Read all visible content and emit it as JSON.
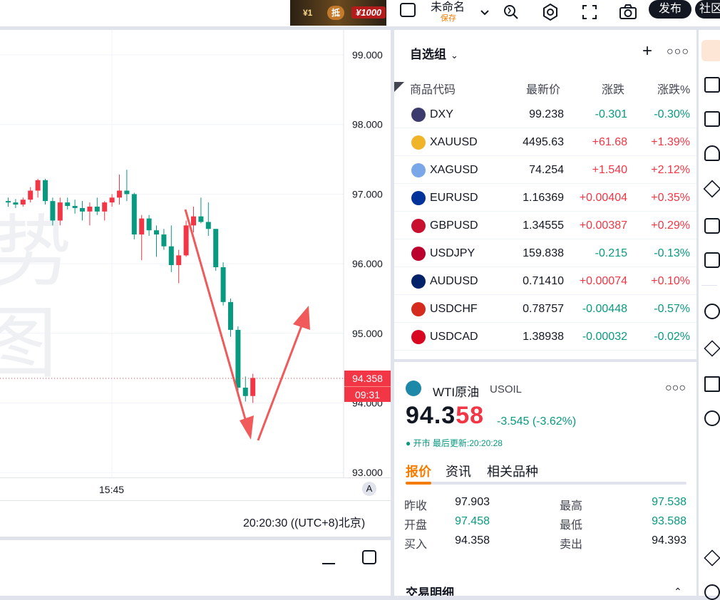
{
  "topbar": {
    "promo": {
      "a": "¥1",
      "b": "抵",
      "c": "¥1000"
    },
    "doc_name": "未命名",
    "doc_status": "保存",
    "publish_label": "发布",
    "community_label": "社区"
  },
  "chart": {
    "price_ticks": [
      "99.000",
      "98.000",
      "97.000",
      "96.000",
      "95.000",
      "94.000",
      "93.000"
    ],
    "last_price_label": "94.358",
    "countdown_label": "09:31",
    "time_tick": "15:45",
    "auto_label": "A",
    "watermark_chars": [
      "势",
      "图"
    ],
    "clock": "20:20:30 ((UTC+8)北京)",
    "up_color": "#f23645",
    "down_color": "#089981"
  },
  "bottom_panel": {
    "min_icon": "minimize-icon",
    "max_icon": "maximize-icon"
  },
  "watchlist": {
    "title": "自选组",
    "columns": {
      "symbol": "商品代码",
      "last": "最新价",
      "chg": "涨跌",
      "chg_pct": "涨跌%"
    },
    "rows": [
      {
        "sym": "DXY",
        "last": "99.238",
        "chg": "-0.301",
        "pct": "-0.30%",
        "dir": "neg",
        "flag": "#3c3b6e"
      },
      {
        "sym": "XAUUSD",
        "last": "4495.63",
        "chg": "+61.68",
        "pct": "+1.39%",
        "dir": "pos",
        "flag": "#f0b429"
      },
      {
        "sym": "XAGUSD",
        "last": "74.254",
        "chg": "+1.540",
        "pct": "+2.12%",
        "dir": "pos",
        "flag": "#7aa7e8"
      },
      {
        "sym": "EURUSD",
        "last": "1.16369",
        "chg": "+0.00404",
        "pct": "+0.35%",
        "dir": "pos",
        "flag": "#003399"
      },
      {
        "sym": "GBPUSD",
        "last": "1.34555",
        "chg": "+0.00387",
        "pct": "+0.29%",
        "dir": "pos",
        "flag": "#c8102e"
      },
      {
        "sym": "USDJPY",
        "last": "159.838",
        "chg": "-0.215",
        "pct": "-0.13%",
        "dir": "neg",
        "flag": "#bc002d"
      },
      {
        "sym": "AUDUSD",
        "last": "0.71410",
        "chg": "+0.00074",
        "pct": "+0.10%",
        "dir": "pos",
        "flag": "#012169"
      },
      {
        "sym": "USDCHF",
        "last": "0.78757",
        "chg": "-0.00448",
        "pct": "-0.57%",
        "dir": "neg",
        "flag": "#d52b1e"
      },
      {
        "sym": "USDCAD",
        "last": "1.38938",
        "chg": "-0.00032",
        "pct": "-0.02%",
        "dir": "neg",
        "flag": "#d80621"
      }
    ]
  },
  "details": {
    "name": "WTI原油",
    "symbol": "USOIL",
    "price_head": "94.3",
    "price_tail": "58",
    "change": "-3.545 (-3.62%)",
    "status": "● 开市 最后更新:20:20:28",
    "tabs": [
      "报价",
      "资讯",
      "相关品种"
    ],
    "stats": [
      {
        "label": "昨收",
        "value": "97.903",
        "label2": "最高",
        "value2": "97.538"
      },
      {
        "label": "开盘",
        "value": "97.458",
        "label2": "最低",
        "value2": "93.588"
      },
      {
        "label": "买入",
        "value": "94.358",
        "label2": "卖出",
        "value2": "94.393"
      }
    ],
    "trades_title": "交易明细"
  }
}
